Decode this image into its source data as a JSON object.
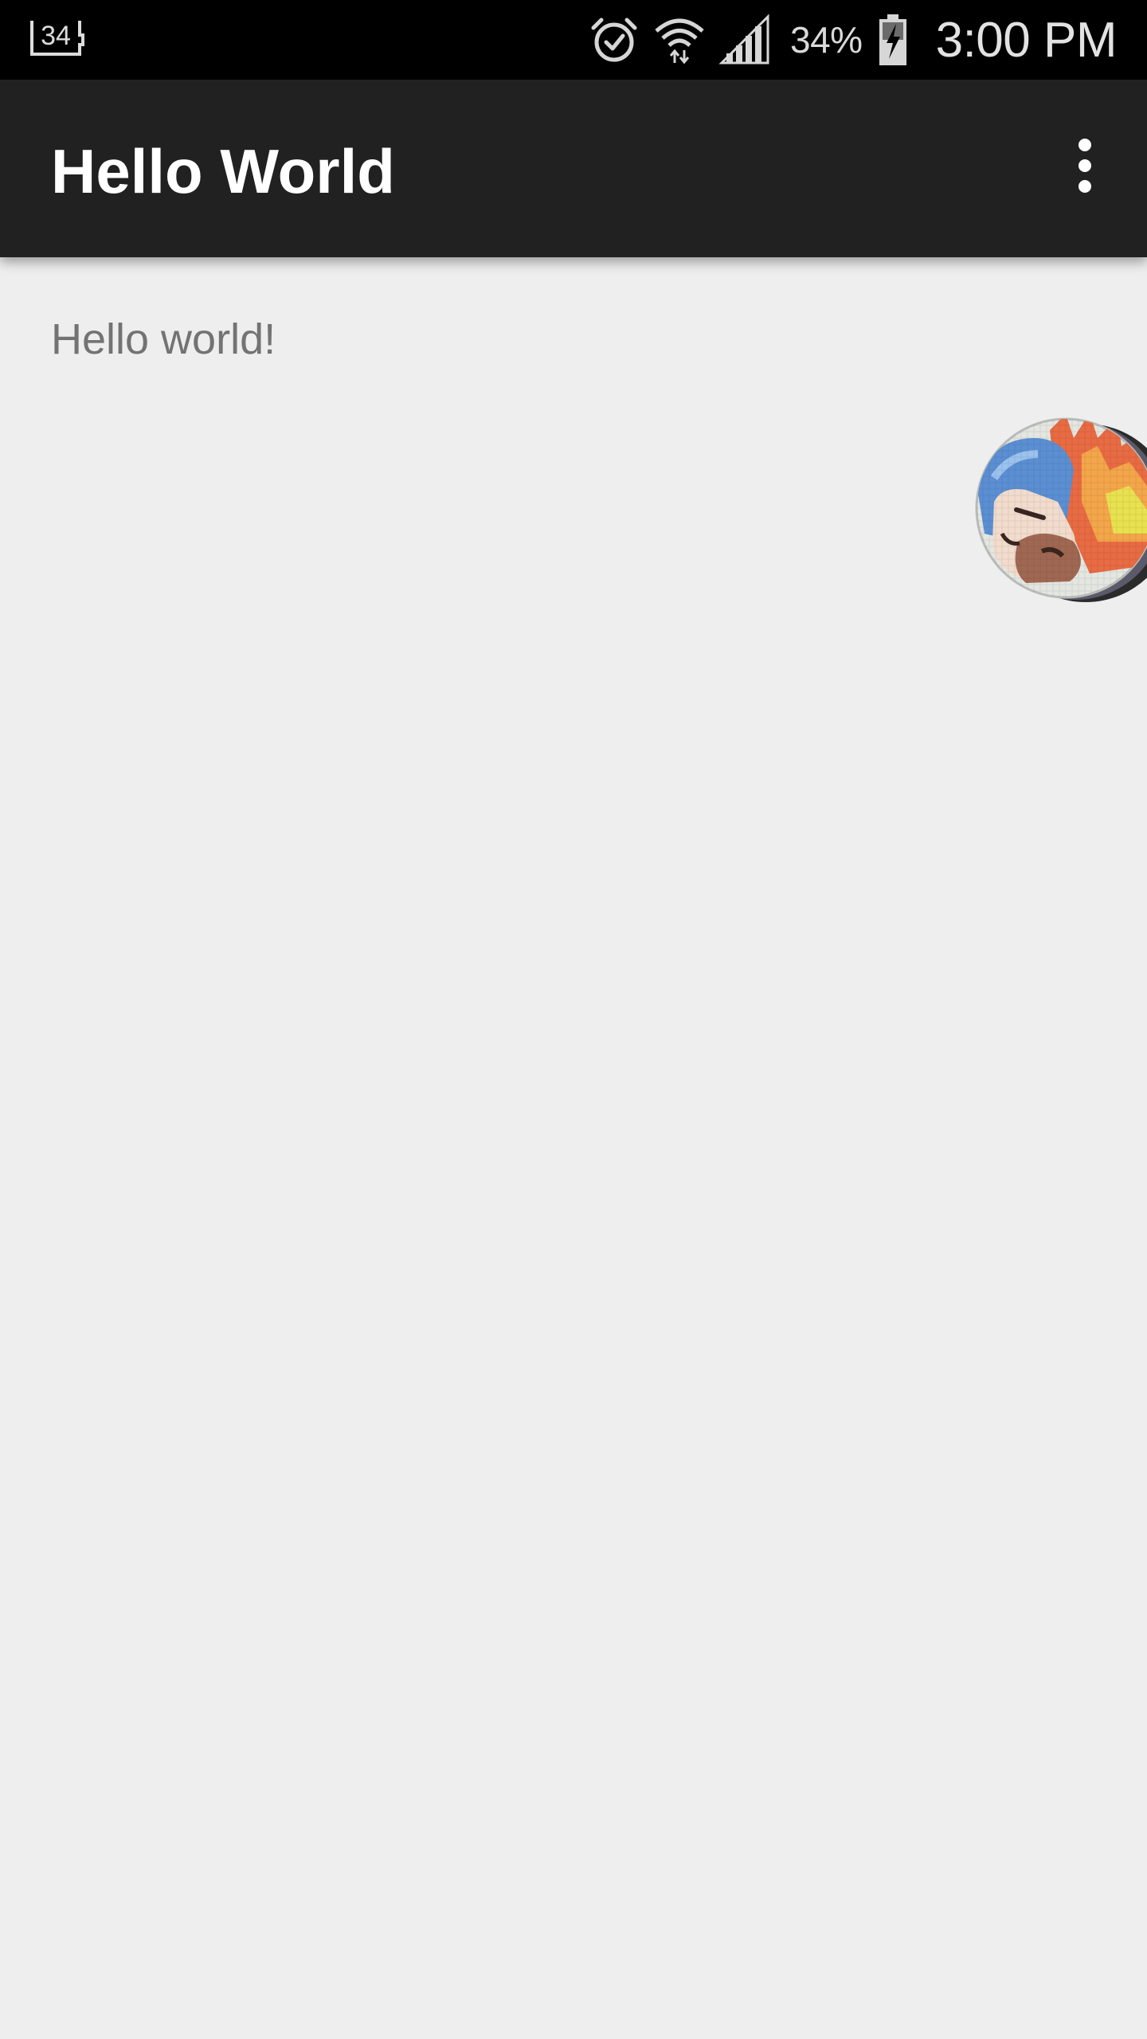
{
  "status_bar": {
    "notification_badge": "34",
    "battery_percent": "34%",
    "time": "3:00 PM",
    "icons": [
      "notification-34-icon",
      "alarm-icon",
      "wifi-icon",
      "signal-icon",
      "battery-charging-icon"
    ]
  },
  "app_bar": {
    "title": "Hello World",
    "overflow_icon": "more-vert-icon"
  },
  "content": {
    "text": "Hello world!"
  },
  "floating": {
    "chat_head_icon": "pixel-art-avatar-icon"
  },
  "colors": {
    "status_bar_bg": "#000000",
    "app_bar_bg": "#212121",
    "page_bg": "#eeeeef",
    "body_text": "#737373"
  }
}
